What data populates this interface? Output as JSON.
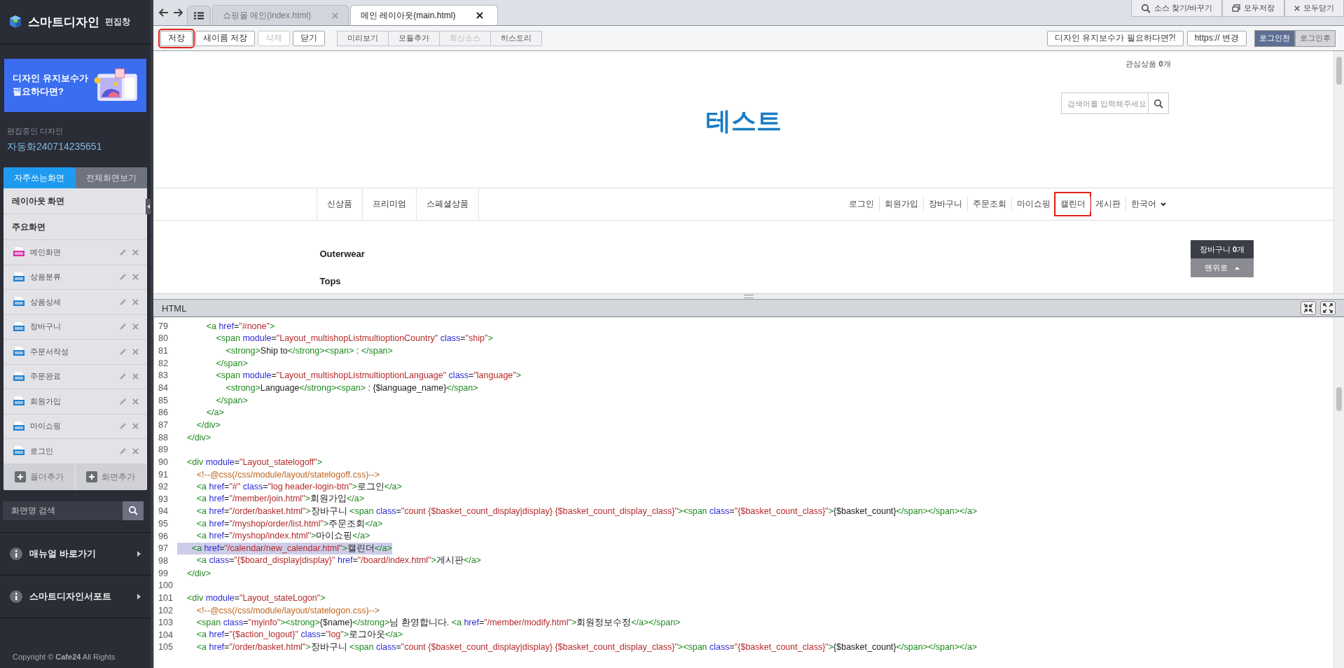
{
  "sidebar": {
    "title": "스마트디자인",
    "subtitle": "편집창",
    "banner": {
      "text": "디자인 유지보수가 필요하다면?"
    },
    "editing_label": "편집중인 디자인",
    "design_name": "자동화240714235651",
    "tabs": [
      {
        "label": "자주쓰는화면",
        "selected": true
      },
      {
        "label": "전체화면보기",
        "selected": false
      }
    ],
    "screens": [
      {
        "kind": "section",
        "label": "레이아웃 화면"
      },
      {
        "kind": "section",
        "label": "주요화면"
      },
      {
        "kind": "main",
        "label": "메인화면"
      },
      {
        "kind": "html",
        "label": "상품분류"
      },
      {
        "kind": "html",
        "label": "상품상세"
      },
      {
        "kind": "html",
        "label": "장바구니"
      },
      {
        "kind": "html",
        "label": "주문서작성"
      },
      {
        "kind": "html",
        "label": "주문완료"
      },
      {
        "kind": "html",
        "label": "회원가입"
      },
      {
        "kind": "html",
        "label": "마이쇼핑"
      },
      {
        "kind": "html",
        "label": "로그인"
      }
    ],
    "actions": [
      "폴더추가",
      "화면추가"
    ],
    "search": {
      "placeholder": "화면명 검색"
    },
    "links": [
      "매뉴얼 바로가기",
      "스마트디자인서포트"
    ],
    "copyright": "Copyright © **Cafe24** All Rights"
  },
  "editor_tabs": [
    {
      "label": "쇼핑몰 메인(index.html)",
      "selected": false
    },
    {
      "label": "메인 레이아웃(main.html)",
      "selected": true
    }
  ],
  "top_actions": [
    {
      "kind": "search",
      "label": "소스 찾기/바꾸기"
    },
    {
      "kind": "windows",
      "label": "모두저장"
    },
    {
      "kind": "close",
      "label": "모두닫기"
    }
  ],
  "toolbar": {
    "file_buttons": [
      {
        "label": "저장",
        "disabled": false,
        "highlighted": true
      },
      {
        "label": "새이름 저장",
        "disabled": false,
        "highlighted": false
      },
      {
        "label": "삭제",
        "disabled": true,
        "highlighted": false
      },
      {
        "label": "닫기",
        "disabled": false,
        "highlighted": false
      }
    ],
    "view_buttons": [
      {
        "label": "미리보기",
        "disabled": false
      },
      {
        "label": "모듈추가",
        "disabled": false
      },
      {
        "label": "최신소스",
        "disabled": true
      },
      {
        "label": "히스토리",
        "disabled": false
      }
    ],
    "right_buttons": [
      "디자인 유지보수가 필요하다면?!",
      "https:// 변경"
    ],
    "login_states": [
      {
        "label": "로그인전",
        "selected": true
      },
      {
        "label": "로그인후",
        "selected": false
      }
    ]
  },
  "preview": {
    "wishlist": "관심상품 **0**개",
    "logo": "테스트",
    "search": {
      "placeholder": "검색어를 입력해주세요"
    },
    "categories": [
      "신상품",
      "프리미엄",
      "스페셜상품"
    ],
    "member_links": [
      {
        "label": "로그인",
        "highlighted": false
      },
      {
        "label": "회원가입",
        "highlighted": false
      },
      {
        "label": "장바구니",
        "highlighted": false
      },
      {
        "label": "주문조회",
        "highlighted": false
      },
      {
        "label": "마이쇼핑",
        "highlighted": false
      },
      {
        "label": "캘린더",
        "highlighted": true
      },
      {
        "label": "게시판",
        "highlighted": false
      }
    ],
    "language": "한국어",
    "menu": [
      "Outerwear",
      "Tops"
    ],
    "cart": "장바구니 **0**개",
    "top_button": "맨위로"
  },
  "code_panel": {
    "title": "HTML",
    "lines": [
      {
        "number": "79",
        "selected": false,
        "tokens": [
          {
            "kind": "tag",
            "text": "            <a "
          },
          {
            "kind": "attr",
            "text": "href"
          },
          {
            "kind": "text",
            "text": "="
          },
          {
            "kind": "value",
            "text": "\"#none\""
          },
          {
            "kind": "tag",
            "text": ">"
          }
        ]
      },
      {
        "number": "80",
        "selected": false,
        "tokens": [
          {
            "kind": "tag",
            "text": "                <span "
          },
          {
            "kind": "attr",
            "text": "module"
          },
          {
            "kind": "text",
            "text": "="
          },
          {
            "kind": "value",
            "text": "\"Layout_multishopListmultioptionCountry\""
          },
          {
            "kind": "attr",
            "text": " class"
          },
          {
            "kind": "text",
            "text": "="
          },
          {
            "kind": "value",
            "text": "\"ship\""
          },
          {
            "kind": "tag",
            "text": ">"
          }
        ]
      },
      {
        "number": "81",
        "selected": false,
        "tokens": [
          {
            "kind": "tag",
            "text": "                    <strong>"
          },
          {
            "kind": "text",
            "text": "Ship to"
          },
          {
            "kind": "tag",
            "text": "</strong><span>"
          },
          {
            "kind": "text",
            "text": " : "
          },
          {
            "kind": "tag",
            "text": "</span>"
          }
        ]
      },
      {
        "number": "82",
        "selected": false,
        "tokens": [
          {
            "kind": "tag",
            "text": "                </span>"
          }
        ]
      },
      {
        "number": "83",
        "selected": false,
        "tokens": [
          {
            "kind": "tag",
            "text": "                <span "
          },
          {
            "kind": "attr",
            "text": "module"
          },
          {
            "kind": "text",
            "text": "="
          },
          {
            "kind": "value",
            "text": "\"Layout_multishopListmultioptionLanguage\""
          },
          {
            "kind": "attr",
            "text": " class"
          },
          {
            "kind": "text",
            "text": "="
          },
          {
            "kind": "value",
            "text": "\"language\""
          },
          {
            "kind": "tag",
            "text": ">"
          }
        ]
      },
      {
        "number": "84",
        "selected": false,
        "tokens": [
          {
            "kind": "tag",
            "text": "                    <strong>"
          },
          {
            "kind": "text",
            "text": "Language"
          },
          {
            "kind": "tag",
            "text": "</strong><span>"
          },
          {
            "kind": "text",
            "text": " : {$language_name}"
          },
          {
            "kind": "tag",
            "text": "</span>"
          }
        ]
      },
      {
        "number": "85",
        "selected": false,
        "tokens": [
          {
            "kind": "tag",
            "text": "                </span>"
          }
        ]
      },
      {
        "number": "86",
        "selected": false,
        "tokens": [
          {
            "kind": "tag",
            "text": "            </a>"
          }
        ]
      },
      {
        "number": "87",
        "selected": false,
        "tokens": [
          {
            "kind": "tag",
            "text": "        </div>"
          }
        ]
      },
      {
        "number": "88",
        "selected": false,
        "tokens": [
          {
            "kind": "tag",
            "text": "    </div>"
          }
        ]
      },
      {
        "number": "89",
        "selected": false
      },
      {
        "number": "90",
        "selected": false,
        "tokens": [
          {
            "kind": "tag",
            "text": "    <div "
          },
          {
            "kind": "attr",
            "text": "module"
          },
          {
            "kind": "text",
            "text": "="
          },
          {
            "kind": "value",
            "text": "\"Layout_statelogoff\""
          },
          {
            "kind": "tag",
            "text": ">"
          }
        ]
      },
      {
        "number": "91",
        "selected": false,
        "tokens": [
          {
            "kind": "comment",
            "text": "        <!--@css(/css/module/layout/statelogoff.css)-->"
          }
        ]
      },
      {
        "number": "92",
        "selected": false,
        "tokens": [
          {
            "kind": "tag",
            "text": "        <a "
          },
          {
            "kind": "attr",
            "text": "href"
          },
          {
            "kind": "text",
            "text": "="
          },
          {
            "kind": "value",
            "text": "\"#\""
          },
          {
            "kind": "attr",
            "text": " class"
          },
          {
            "kind": "text",
            "text": "="
          },
          {
            "kind": "value",
            "text": "\"log header-login-btn\""
          },
          {
            "kind": "tag",
            "text": ">"
          },
          {
            "kind": "text",
            "text": "로그인"
          },
          {
            "kind": "tag",
            "text": "</a>"
          }
        ]
      },
      {
        "number": "93",
        "selected": false,
        "tokens": [
          {
            "kind": "tag",
            "text": "        <a "
          },
          {
            "kind": "attr",
            "text": "href"
          },
          {
            "kind": "text",
            "text": "="
          },
          {
            "kind": "value",
            "text": "\"/member/join.html\""
          },
          {
            "kind": "tag",
            "text": ">"
          },
          {
            "kind": "text",
            "text": "회원가입"
          },
          {
            "kind": "tag",
            "text": "</a>"
          }
        ]
      },
      {
        "number": "94",
        "selected": false,
        "tokens": [
          {
            "kind": "tag",
            "text": "        <a "
          },
          {
            "kind": "attr",
            "text": "href"
          },
          {
            "kind": "text",
            "text": "="
          },
          {
            "kind": "value",
            "text": "\"/order/basket.html\""
          },
          {
            "kind": "tag",
            "text": ">"
          },
          {
            "kind": "text",
            "text": "장바구니 "
          },
          {
            "kind": "tag",
            "text": "<span "
          },
          {
            "kind": "attr",
            "text": "class"
          },
          {
            "kind": "text",
            "text": "="
          },
          {
            "kind": "value",
            "text": "\"count {$basket_count_display|display} {$basket_count_display_class}\""
          },
          {
            "kind": "tag",
            "text": "><span "
          },
          {
            "kind": "attr",
            "text": "class"
          },
          {
            "kind": "text",
            "text": "="
          },
          {
            "kind": "value",
            "text": "\"{$basket_count_class}\""
          },
          {
            "kind": "tag",
            "text": ">"
          },
          {
            "kind": "text",
            "text": "{$basket_count}"
          },
          {
            "kind": "tag",
            "text": "</span></span></a>"
          }
        ]
      },
      {
        "number": "95",
        "selected": false,
        "tokens": [
          {
            "kind": "tag",
            "text": "        <a "
          },
          {
            "kind": "attr",
            "text": "href"
          },
          {
            "kind": "text",
            "text": "="
          },
          {
            "kind": "value",
            "text": "\"/myshop/order/list.html\""
          },
          {
            "kind": "tag",
            "text": ">"
          },
          {
            "kind": "text",
            "text": "주문조회"
          },
          {
            "kind": "tag",
            "text": "</a>"
          }
        ]
      },
      {
        "number": "96",
        "selected": false,
        "tokens": [
          {
            "kind": "tag",
            "text": "        <a "
          },
          {
            "kind": "attr",
            "text": "href"
          },
          {
            "kind": "text",
            "text": "="
          },
          {
            "kind": "value",
            "text": "\"/myshop/index.html\""
          },
          {
            "kind": "tag",
            "text": ">"
          },
          {
            "kind": "text",
            "text": "마이쇼핑"
          },
          {
            "kind": "tag",
            "text": "</a>"
          }
        ]
      },
      {
        "number": "97",
        "selected": true,
        "tokens": [
          {
            "kind": "tag",
            "text": "      <a "
          },
          {
            "kind": "attr",
            "text": "href"
          },
          {
            "kind": "text",
            "text": "="
          },
          {
            "kind": "value",
            "text": "\"/calendar/new_calendar.html\""
          },
          {
            "kind": "tag",
            "text": ">"
          },
          {
            "kind": "text",
            "text": "캘린더"
          },
          {
            "kind": "tag",
            "text": "</a>"
          }
        ]
      },
      {
        "number": "98",
        "selected": false,
        "tokens": [
          {
            "kind": "tag",
            "text": "        <a "
          },
          {
            "kind": "attr",
            "text": "class"
          },
          {
            "kind": "text",
            "text": "="
          },
          {
            "kind": "value",
            "text": "\"{$board_display|display}\""
          },
          {
            "kind": "attr",
            "text": " href"
          },
          {
            "kind": "text",
            "text": "="
          },
          {
            "kind": "value",
            "text": "\"/board/index.html\""
          },
          {
            "kind": "tag",
            "text": ">"
          },
          {
            "kind": "text",
            "text": "게시판"
          },
          {
            "kind": "tag",
            "text": "</a>"
          }
        ]
      },
      {
        "number": "99",
        "selected": false,
        "tokens": [
          {
            "kind": "tag",
            "text": "    </div>"
          }
        ]
      },
      {
        "number": "100",
        "selected": false
      },
      {
        "number": "101",
        "selected": false,
        "tokens": [
          {
            "kind": "tag",
            "text": "    <div "
          },
          {
            "kind": "attr",
            "text": "module"
          },
          {
            "kind": "text",
            "text": "="
          },
          {
            "kind": "value",
            "text": "\"Layout_stateLogon\""
          },
          {
            "kind": "tag",
            "text": ">"
          }
        ]
      },
      {
        "number": "102",
        "selected": false,
        "tokens": [
          {
            "kind": "comment",
            "text": "        <!--@css(/css/module/layout/statelogon.css)-->"
          }
        ]
      },
      {
        "number": "103",
        "selected": false,
        "tokens": [
          {
            "kind": "tag",
            "text": "        <span "
          },
          {
            "kind": "attr",
            "text": "class"
          },
          {
            "kind": "text",
            "text": "="
          },
          {
            "kind": "value",
            "text": "\"myinfo\""
          },
          {
            "kind": "tag",
            "text": "><strong>"
          },
          {
            "kind": "text",
            "text": "{$name}"
          },
          {
            "kind": "tag",
            "text": "</strong>"
          },
          {
            "kind": "text",
            "text": "님 환영합니다. "
          },
          {
            "kind": "tag",
            "text": "<a "
          },
          {
            "kind": "attr",
            "text": "href"
          },
          {
            "kind": "text",
            "text": "="
          },
          {
            "kind": "value",
            "text": "\"/member/modify.html\""
          },
          {
            "kind": "tag",
            "text": ">"
          },
          {
            "kind": "text",
            "text": "회원정보수정"
          },
          {
            "kind": "tag",
            "text": "</a></span>"
          }
        ]
      },
      {
        "number": "104",
        "selected": false,
        "tokens": [
          {
            "kind": "tag",
            "text": "        <a "
          },
          {
            "kind": "attr",
            "text": "href"
          },
          {
            "kind": "text",
            "text": "="
          },
          {
            "kind": "value",
            "text": "\"{$action_logout}\""
          },
          {
            "kind": "attr",
            "text": " class"
          },
          {
            "kind": "text",
            "text": "="
          },
          {
            "kind": "value",
            "text": "\"log\""
          },
          {
            "kind": "tag",
            "text": ">"
          },
          {
            "kind": "text",
            "text": "로그아웃"
          },
          {
            "kind": "tag",
            "text": "</a>"
          }
        ]
      },
      {
        "number": "105",
        "selected": false,
        "tokens": [
          {
            "kind": "tag",
            "text": "        <a "
          },
          {
            "kind": "attr",
            "text": "href"
          },
          {
            "kind": "text",
            "text": "="
          },
          {
            "kind": "value",
            "text": "\"/order/basket.html\""
          },
          {
            "kind": "tag",
            "text": ">"
          },
          {
            "kind": "text",
            "text": "장바구니 "
          },
          {
            "kind": "tag",
            "text": "<span "
          },
          {
            "kind": "attr",
            "text": "class"
          },
          {
            "kind": "text",
            "text": "="
          },
          {
            "kind": "value",
            "text": "\"count {$basket_count_display|display} {$basket_count_display_class}\""
          },
          {
            "kind": "tag",
            "text": "><span "
          },
          {
            "kind": "attr",
            "text": "class"
          },
          {
            "kind": "text",
            "text": "="
          },
          {
            "kind": "value",
            "text": "\"{$basket_count_class}\""
          },
          {
            "kind": "tag",
            "text": ">"
          },
          {
            "kind": "text",
            "text": "{$basket_count}"
          },
          {
            "kind": "tag",
            "text": "</span></span></a>"
          }
        ]
      }
    ]
  }
}
